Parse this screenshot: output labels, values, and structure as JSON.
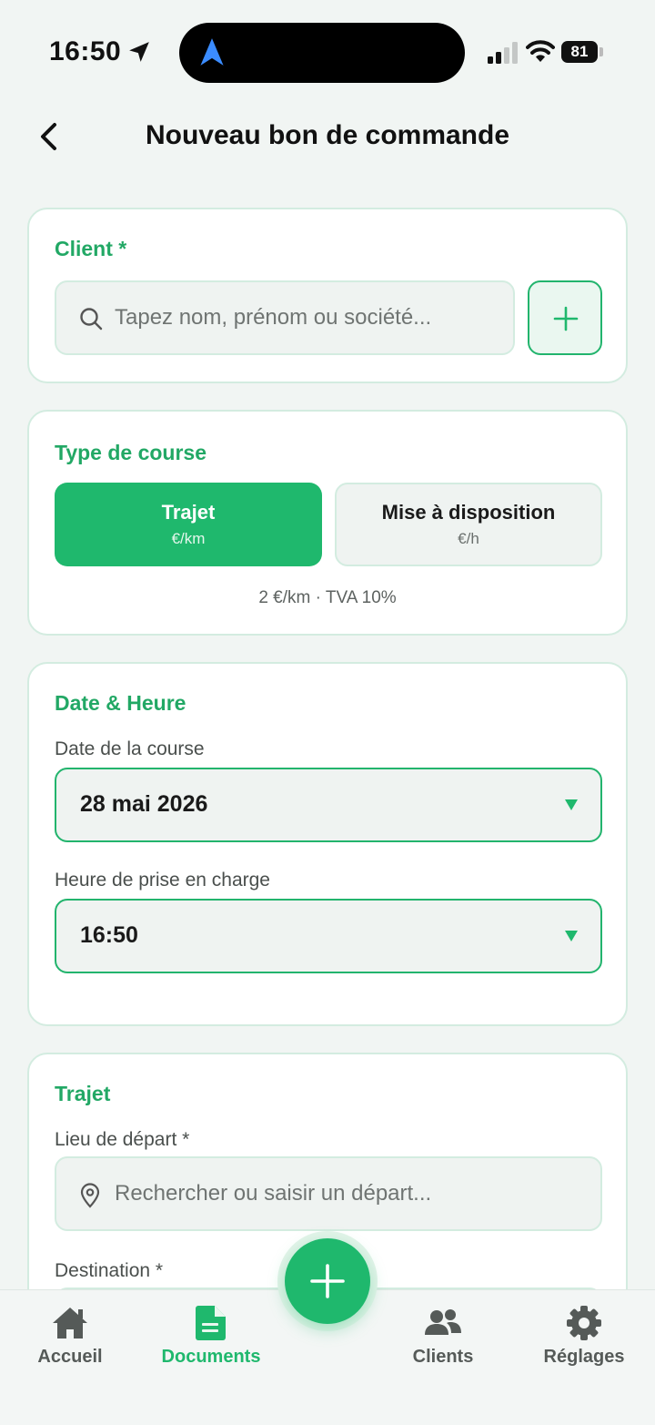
{
  "status_bar": {
    "time": "16:50",
    "battery": "81"
  },
  "header": {
    "title": "Nouveau bon de commande"
  },
  "client_section": {
    "title": "Client *",
    "search_placeholder": "Tapez nom, prénom ou société..."
  },
  "course_type": {
    "title": "Type de course",
    "options": [
      {
        "label": "Trajet",
        "unit": "€/km",
        "selected": true
      },
      {
        "label": "Mise à disposition",
        "unit": "€/h",
        "selected": false
      }
    ],
    "rate_info": "2 €/km · TVA 10%"
  },
  "datetime": {
    "title": "Date & Heure",
    "date_label": "Date de la course",
    "date_value": "28 mai 2026",
    "time_label": "Heure de prise en charge",
    "time_value": "16:50"
  },
  "route": {
    "title": "Trajet",
    "departure_label": "Lieu de départ *",
    "departure_placeholder": "Rechercher ou saisir un départ...",
    "destination_label": "Destination *"
  },
  "bottom_nav": {
    "items": [
      {
        "label": "Accueil",
        "icon": "home-icon",
        "active": false
      },
      {
        "label": "Documents",
        "icon": "document-icon",
        "active": true
      },
      {
        "label": "Clients",
        "icon": "users-icon",
        "active": false
      },
      {
        "label": "Réglages",
        "icon": "gear-icon",
        "active": false
      }
    ]
  },
  "colors": {
    "accent": "#1fb86d",
    "accent_text": "#22a865",
    "card_border": "#d3ece0",
    "background": "#f1f5f3"
  }
}
